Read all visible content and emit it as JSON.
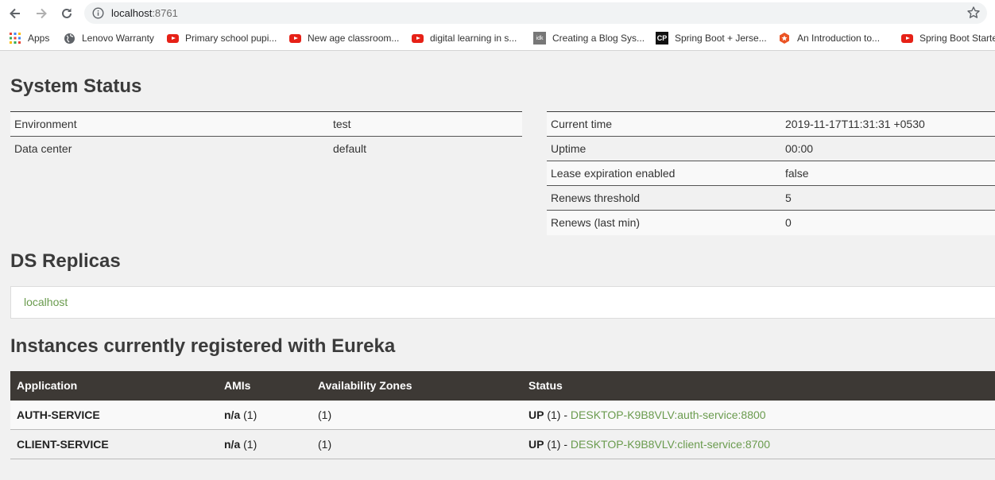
{
  "browser": {
    "url_host": "localhost",
    "url_port": ":8761",
    "bookmarks": [
      {
        "label": "Apps",
        "icon": "apps-grid-icon"
      },
      {
        "label": "Lenovo Warranty",
        "icon": "globe-icon"
      },
      {
        "label": "Primary school pupi...",
        "icon": "youtube-icon"
      },
      {
        "label": "New age classroom...",
        "icon": "youtube-icon"
      },
      {
        "label": "digital learning in s...",
        "icon": "youtube-icon"
      },
      {
        "label": "Creating a Blog Sys...",
        "icon": "idk-icon"
      },
      {
        "label": "Spring Boot + Jerse...",
        "icon": "cp-icon"
      },
      {
        "label": "An Introduction to...",
        "icon": "badge-icon"
      },
      {
        "label": "Spring Boot Starte",
        "icon": "youtube-icon"
      }
    ]
  },
  "system_status": {
    "title": "System Status",
    "left": [
      {
        "key": "Environment",
        "value": "test"
      },
      {
        "key": "Data center",
        "value": "default"
      }
    ],
    "right": [
      {
        "key": "Current time",
        "value": "2019-11-17T11:31:31 +0530"
      },
      {
        "key": "Uptime",
        "value": "00:00"
      },
      {
        "key": "Lease expiration enabled",
        "value": "false"
      },
      {
        "key": "Renews threshold",
        "value": "5"
      },
      {
        "key": "Renews (last min)",
        "value": "0"
      }
    ]
  },
  "replicas": {
    "title": "DS Replicas",
    "items": [
      "localhost"
    ]
  },
  "instances": {
    "title": "Instances currently registered with Eureka",
    "columns": [
      "Application",
      "AMIs",
      "Availability Zones",
      "Status"
    ],
    "rows": [
      {
        "application": "AUTH-SERVICE",
        "amis_label": "n/a",
        "amis_count": "(1)",
        "zones": "(1)",
        "status_label": "UP",
        "status_count": "(1) -",
        "instance": "DESKTOP-K9B8VLV:auth-service:8800"
      },
      {
        "application": "CLIENT-SERVICE",
        "amis_label": "n/a",
        "amis_count": "(1)",
        "zones": "(1)",
        "status_label": "UP",
        "status_count": "(1) -",
        "instance": "DESKTOP-K9B8VLV:client-service:8700"
      }
    ]
  },
  "colors": {
    "header_bg": "#3d3935",
    "link": "#6a9b4e",
    "page_bg": "#f1f1f1"
  }
}
